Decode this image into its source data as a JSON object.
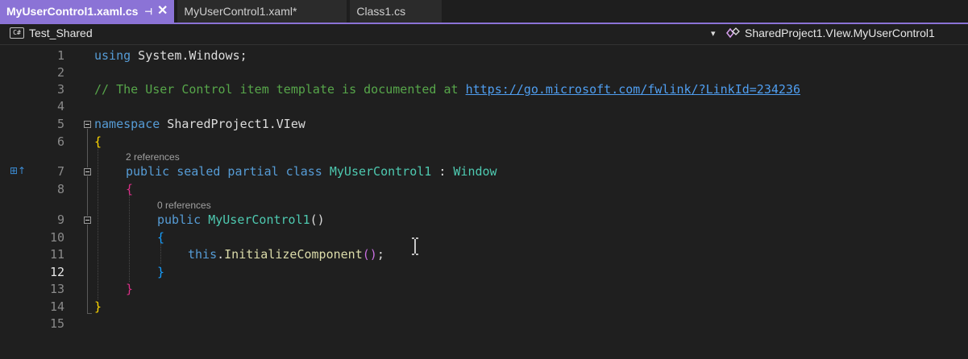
{
  "tabs": [
    {
      "label": "MyUserControl1.xaml.cs",
      "active": true,
      "pin_icon": "pin-icon",
      "close_icon": "close-icon"
    },
    {
      "label": "MyUserControl1.xaml*",
      "active": false
    },
    {
      "label": "Class1.cs",
      "active": false
    }
  ],
  "navbar": {
    "project": "Test_Shared",
    "project_icon": "C#",
    "scope": "SharedProject1.VIew.MyUserControl1"
  },
  "colors": {
    "accent": "#8b73d6",
    "keyword": "#569cd6",
    "type": "#4ec9b0",
    "comment": "#57a64a",
    "method": "#dcdcaa"
  },
  "editor": {
    "current_line": 12,
    "line_numbers": [
      "1",
      "2",
      "3",
      "4",
      "5",
      "6",
      "7",
      "8",
      "9",
      "10",
      "11",
      "12",
      "13",
      "14",
      "15"
    ],
    "lines": {
      "l1_kw": "using",
      "l1_rest": " System.Windows;",
      "l3_comment": "// The User Control item template is documented at ",
      "l3_link": "https://go.microsoft.com/fwlink/?LinkId=234236",
      "l5_kw": "namespace",
      "l5_name": " SharedProject1.VIew",
      "l6_brace": "{",
      "l7_lens": "2 references",
      "l7_public": "public",
      "l7_sealed": " sealed",
      "l7_partial": " partial",
      "l7_class": " class",
      "l7_name": " MyUserControl1",
      "l7_colon": " : ",
      "l7_base": "Window",
      "l8_brace": "{",
      "l9_lens": "0 references",
      "l9_public": "public",
      "l9_name": " MyUserControl1",
      "l9_parens": "()",
      "l10_brace": "{",
      "l11_this": "this",
      "l11_dot": ".",
      "l11_method": "InitializeComponent",
      "l11_parens": "()",
      "l11_semi": ";",
      "l12_brace": "}",
      "l13_brace": "}",
      "l14_brace": "}"
    }
  }
}
